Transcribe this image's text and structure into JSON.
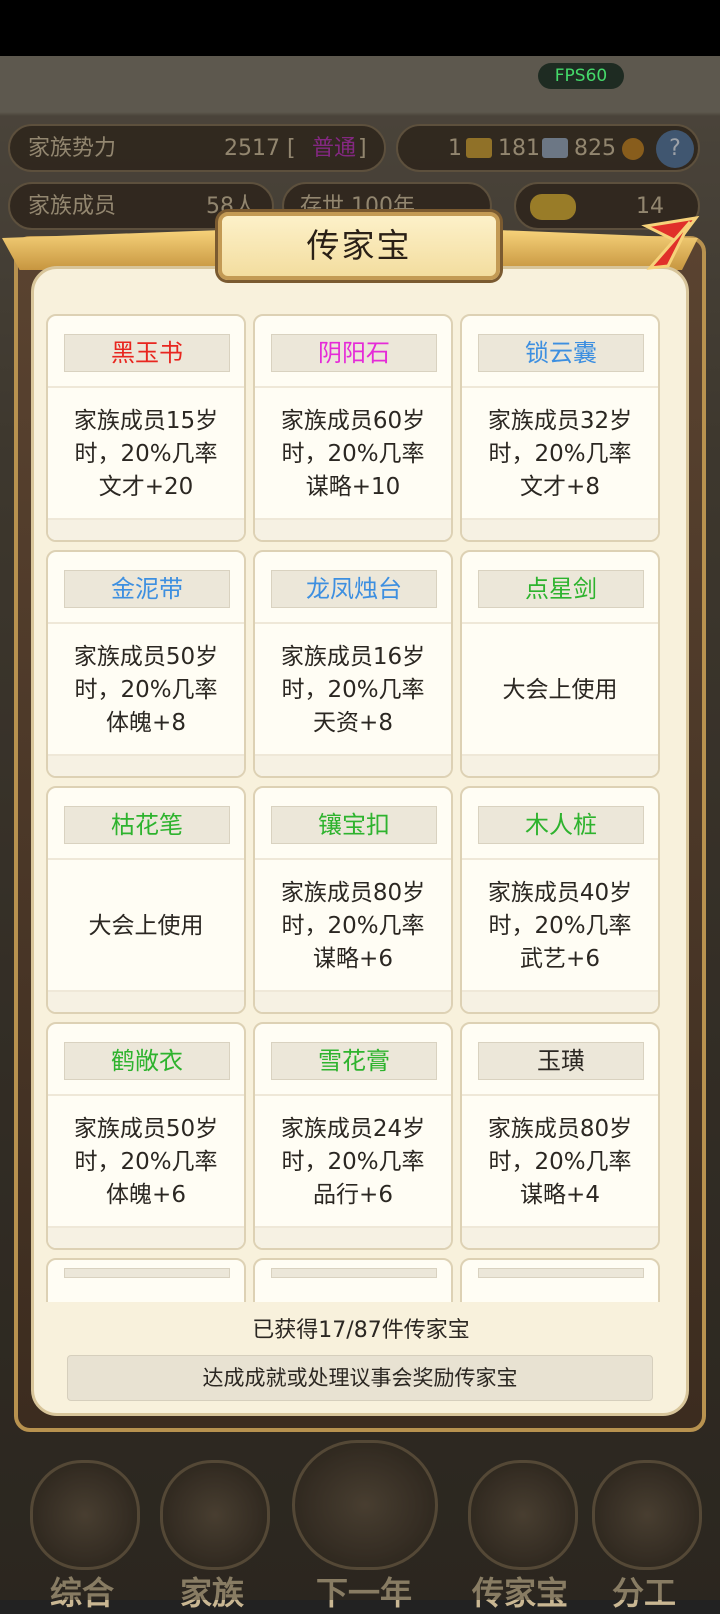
{
  "fps_label": "FPS60",
  "hud": {
    "influence_label": "家族势力",
    "influence_value": "2517 [",
    "influence_rank": "普通",
    "influence_close": "]",
    "gold_value": "1",
    "ingot_value": "181",
    "silver_value": "825",
    "members_label": "家族成员",
    "members_value": "58人",
    "exist_label": "存世 100年",
    "yuanbao_value": "14"
  },
  "dialog": {
    "title": "传家宝",
    "items": [
      {
        "name": "黑玉书",
        "name_color": "#e8261f",
        "desc": "家族成员15岁\n时，20%几率\n文才+20"
      },
      {
        "name": "阴阳石",
        "name_color": "#e52bd8",
        "desc": "家族成员60岁\n时，20%几率\n谋略+10"
      },
      {
        "name": "锁云囊",
        "name_color": "#3d8fe0",
        "desc": "家族成员32岁\n时，20%几率\n文才+8"
      },
      {
        "name": "金泥带",
        "name_color": "#3d8fe0",
        "desc": "家族成员50岁\n时，20%几率\n体魄+8"
      },
      {
        "name": "龙凤烛台",
        "name_color": "#3d8fe0",
        "desc": "家族成员16岁\n时，20%几率\n天资+8"
      },
      {
        "name": "点星剑",
        "name_color": "#2eb32e",
        "desc": "大会上使用"
      },
      {
        "name": "枯花笔",
        "name_color": "#2eb32e",
        "desc": "大会上使用"
      },
      {
        "name": "镶宝扣",
        "name_color": "#2eb32e",
        "desc": "家族成员80岁\n时，20%几率\n谋略+6"
      },
      {
        "name": "木人桩",
        "name_color": "#2eb32e",
        "desc": "家族成员40岁\n时，20%几率\n武艺+6"
      },
      {
        "name": "鹤敞衣",
        "name_color": "#2eb32e",
        "desc": "家族成员50岁\n时，20%几率\n体魄+6"
      },
      {
        "name": "雪花膏",
        "name_color": "#2eb32e",
        "desc": "家族成员24岁\n时，20%几率\n品行+6"
      },
      {
        "name": "玉璜",
        "name_color": "#2b2722",
        "desc": "家族成员80岁\n时，20%几率\n谋略+4"
      }
    ],
    "count_text": "已获得17/87件传家宝",
    "hint_text": "达成成就或处理议事会奖励传家宝"
  },
  "nav": {
    "items": [
      {
        "label": "综合"
      },
      {
        "label": "家族"
      },
      {
        "label": "下一年"
      },
      {
        "label": "传家宝"
      },
      {
        "label": "分工"
      }
    ]
  }
}
